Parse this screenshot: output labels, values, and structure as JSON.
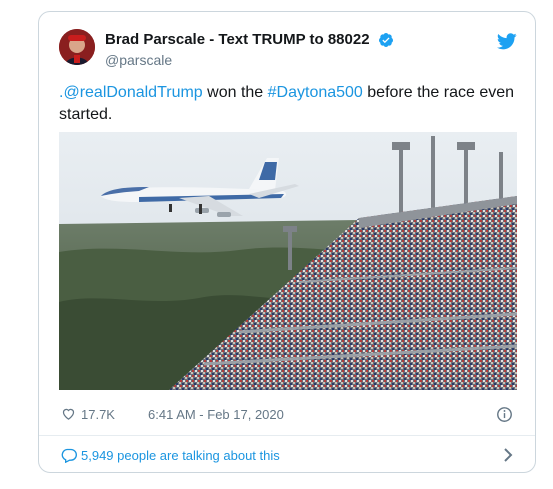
{
  "tweet": {
    "display_name": "Brad Parscale - Text TRUMP to 88022",
    "handle": "@parscale",
    "text": {
      "mention": ".@realDonaldTrump",
      "middle": " won the ",
      "hashtag": "#Daytona500",
      "end": " before the race even started."
    },
    "likes": "17.7K",
    "timestamp": "6:41 AM - Feb 17, 2020",
    "conversation": "5,949 people are talking about this"
  },
  "icons": {
    "verified": "verified-badge-icon",
    "logo": "twitter-bird-icon",
    "like": "heart-icon",
    "info": "info-icon",
    "conversation": "speech-bubble-icon",
    "more": "chevron-right-icon"
  },
  "colors": {
    "link": "#1b95e0",
    "text": "#14171a",
    "muted": "#657786",
    "border": "#ccd6dd"
  }
}
